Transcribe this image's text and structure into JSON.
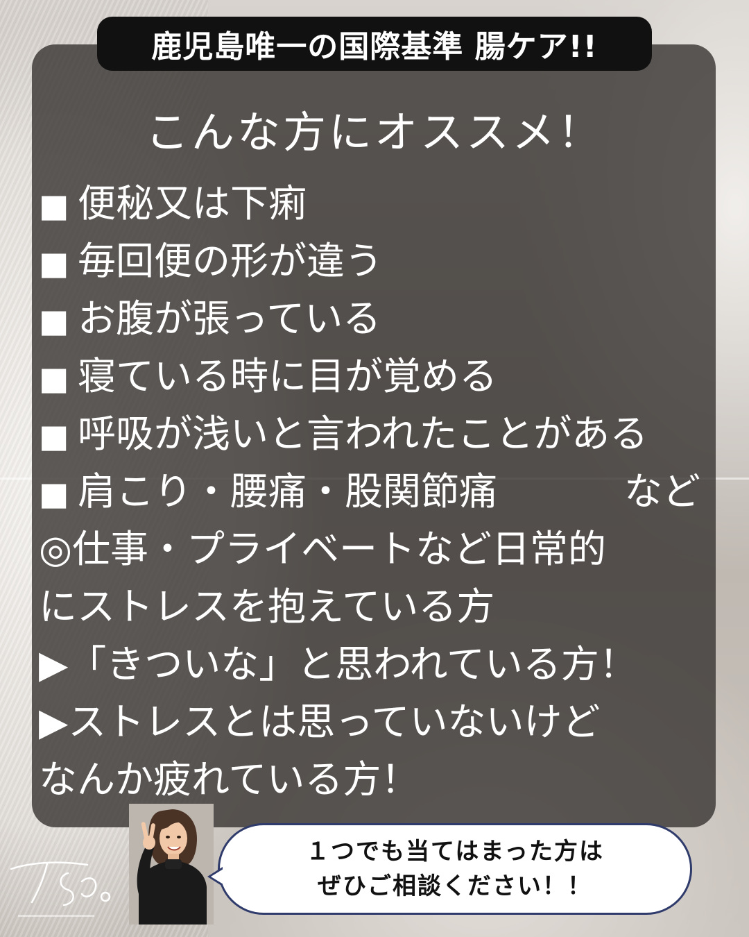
{
  "title": "鹿児島唯一の国際基準  腸ケア!!",
  "heading": "こんな方にオススメ！",
  "items": [
    {
      "bullet": "■",
      "text": "便秘又は下痢",
      "suffix": ""
    },
    {
      "bullet": "■",
      "text": "毎回便の形が違う",
      "suffix": ""
    },
    {
      "bullet": "■",
      "text": "お腹が張っている",
      "suffix": ""
    },
    {
      "bullet": "■",
      "text": "寝ている時に目が覚める",
      "suffix": ""
    },
    {
      "bullet": "■",
      "text": "呼吸が浅いと言われたことがある",
      "suffix": ""
    },
    {
      "bullet": "■",
      "text": "肩こり・腰痛・股関節痛",
      "suffix": "など"
    }
  ],
  "paragraphs": [
    "◎仕事・プライベートなど日常的",
    "にストレスを抱えている方",
    "▶「きついな」と思われている方！",
    "▶ストレスとは思っていないけど",
    "なんか疲れている方！"
  ],
  "bubble": {
    "line1": "１つでも当てはまった方は",
    "line2": "ぜひご相談ください！！"
  },
  "colors": {
    "panel": "#3a3734",
    "title_bg": "#111111",
    "text": "#ffffff",
    "bubble_border": "#2f3b6b"
  },
  "icons": {
    "person": "woman-peace-sign-illustration",
    "logo": "ts-signature-logo"
  }
}
